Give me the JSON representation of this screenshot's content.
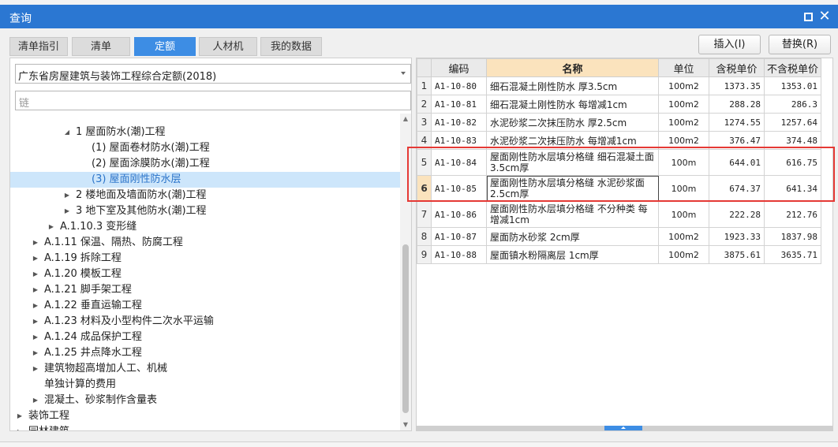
{
  "window": {
    "title": "查询"
  },
  "tabs": [
    {
      "label": "清单指引",
      "active": false
    },
    {
      "label": "清单",
      "active": false
    },
    {
      "label": "定额",
      "active": true
    },
    {
      "label": "人材机",
      "active": false
    },
    {
      "label": "我的数据",
      "active": false
    }
  ],
  "actions": {
    "insert": "插入(I)",
    "replace": "替换(R)"
  },
  "quota_select": {
    "value": "广东省房屋建筑与装饰工程综合定额(2018)"
  },
  "search": {
    "placeholder": "链"
  },
  "tree": [
    {
      "label": "1 屋面防水(潮)工程",
      "level": 3,
      "toggle": "expanded",
      "selected": false
    },
    {
      "label": "(1) 屋面卷材防水(潮)工程",
      "level": 4,
      "toggle": "none",
      "selected": false
    },
    {
      "label": "(2) 屋面涂膜防水(潮)工程",
      "level": 4,
      "toggle": "none",
      "selected": false
    },
    {
      "label": "(3) 屋面刚性防水层",
      "level": 4,
      "toggle": "none",
      "selected": true
    },
    {
      "label": "2 楼地面及墙面防水(潮)工程",
      "level": 3,
      "toggle": "collapsed",
      "selected": false
    },
    {
      "label": "3 地下室及其他防水(潮)工程",
      "level": 3,
      "toggle": "collapsed",
      "selected": false
    },
    {
      "label": "A.1.10.3 变形缝",
      "level": 2,
      "toggle": "collapsed",
      "selected": false
    },
    {
      "label": "A.1.11 保温、隔热、防腐工程",
      "level": 1,
      "toggle": "collapsed",
      "selected": false
    },
    {
      "label": "A.1.19 拆除工程",
      "level": 1,
      "toggle": "collapsed",
      "selected": false
    },
    {
      "label": "A.1.20 模板工程",
      "level": 1,
      "toggle": "collapsed",
      "selected": false
    },
    {
      "label": "A.1.21 脚手架工程",
      "level": 1,
      "toggle": "collapsed",
      "selected": false
    },
    {
      "label": "A.1.22 垂直运输工程",
      "level": 1,
      "toggle": "collapsed",
      "selected": false
    },
    {
      "label": "A.1.23 材料及小型构件二次水平运输",
      "level": 1,
      "toggle": "collapsed",
      "selected": false
    },
    {
      "label": "A.1.24 成品保护工程",
      "level": 1,
      "toggle": "collapsed",
      "selected": false
    },
    {
      "label": "A.1.25 井点降水工程",
      "level": 1,
      "toggle": "collapsed",
      "selected": false
    },
    {
      "label": "建筑物超高增加人工、机械",
      "level": 1,
      "toggle": "collapsed",
      "selected": false
    },
    {
      "label": "单独计算的费用",
      "level": 1,
      "toggle": "none",
      "selected": false
    },
    {
      "label": "混凝土、砂浆制作含量表",
      "level": 1,
      "toggle": "collapsed",
      "selected": false
    },
    {
      "label": "装饰工程",
      "level": 0,
      "toggle": "collapsed",
      "selected": false
    },
    {
      "label": "园林建筑",
      "level": 0,
      "toggle": "collapsed",
      "selected": false
    }
  ],
  "grid": {
    "columns": [
      "",
      "编码",
      "名称",
      "单位",
      "含税单价",
      "不含税单价"
    ],
    "rows": [
      {
        "no": "1",
        "code": "A1-10-80",
        "name": "细石混凝土刚性防水 厚3.5cm",
        "unit": "100m2",
        "tax_price": "1373.35",
        "notax_price": "1353.01"
      },
      {
        "no": "2",
        "code": "A1-10-81",
        "name": "细石混凝土刚性防水 每增减1cm",
        "unit": "100m2",
        "tax_price": "288.28",
        "notax_price": "286.3"
      },
      {
        "no": "3",
        "code": "A1-10-82",
        "name": "水泥砂浆二次抹压防水 厚2.5cm",
        "unit": "100m2",
        "tax_price": "1274.55",
        "notax_price": "1257.64"
      },
      {
        "no": "4",
        "code": "A1-10-83",
        "name": "水泥砂浆二次抹压防水 每增减1cm",
        "unit": "100m2",
        "tax_price": "376.47",
        "notax_price": "374.48"
      },
      {
        "no": "5",
        "code": "A1-10-84",
        "name": "屋面刚性防水层填分格缝 细石混凝土面3.5cm厚",
        "unit": "100m",
        "tax_price": "644.01",
        "notax_price": "616.75"
      },
      {
        "no": "6",
        "code": "A1-10-85",
        "name": "屋面刚性防水层填分格缝 水泥砂浆面2.5cm厚",
        "unit": "100m",
        "tax_price": "674.37",
        "notax_price": "641.34"
      },
      {
        "no": "7",
        "code": "A1-10-86",
        "name": "屋面刚性防水层填分格缝 不分种类 每增减1cm",
        "unit": "100m",
        "tax_price": "222.28",
        "notax_price": "212.76"
      },
      {
        "no": "8",
        "code": "A1-10-87",
        "name": "屋面防水砂浆 2cm厚",
        "unit": "100m2",
        "tax_price": "1923.33",
        "notax_price": "1837.98"
      },
      {
        "no": "9",
        "code": "A1-10-88",
        "name": "屋面镇水粉隔离层 1cm厚",
        "unit": "100m2",
        "tax_price": "3875.61",
        "notax_price": "3635.71"
      }
    ],
    "current_row": "6",
    "highlighted_rows": [
      "5",
      "6"
    ]
  },
  "colors": {
    "title_bar": "#2b77d2",
    "active_tab": "#3d8de4",
    "tree_selected": "#cde6fb",
    "header_highlight": "#fbe3bd",
    "annotation_box": "#e53935"
  }
}
